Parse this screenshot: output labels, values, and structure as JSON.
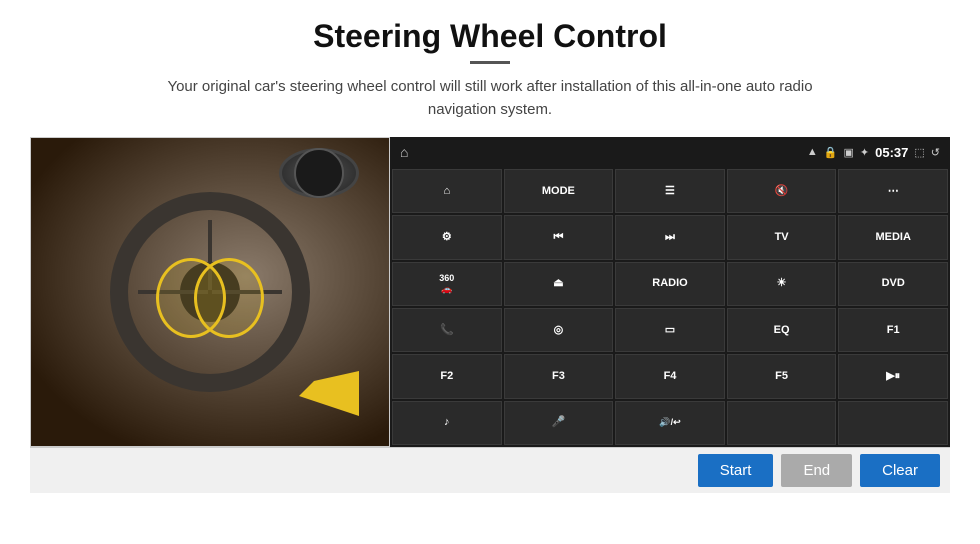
{
  "header": {
    "title": "Steering Wheel Control",
    "subtitle": "Your original car's steering wheel control will still work after installation of this all-in-one auto radio navigation system."
  },
  "status_bar": {
    "time": "05:37",
    "icons": [
      "wifi",
      "lock",
      "sim",
      "bluetooth",
      "camera",
      "back"
    ]
  },
  "grid_buttons": [
    {
      "id": "r1c1",
      "type": "icon",
      "icon": "home",
      "label": ""
    },
    {
      "id": "r1c2",
      "type": "text",
      "label": "MODE"
    },
    {
      "id": "r1c3",
      "type": "icon",
      "icon": "list",
      "label": ""
    },
    {
      "id": "r1c4",
      "type": "icon",
      "icon": "mute",
      "label": ""
    },
    {
      "id": "r1c5",
      "type": "icon",
      "icon": "grid",
      "label": ""
    },
    {
      "id": "r2c1",
      "type": "icon",
      "icon": "settings",
      "label": ""
    },
    {
      "id": "r2c2",
      "type": "icon",
      "icon": "prev",
      "label": ""
    },
    {
      "id": "r2c3",
      "type": "icon",
      "icon": "next",
      "label": ""
    },
    {
      "id": "r2c4",
      "type": "text",
      "label": "TV"
    },
    {
      "id": "r2c5",
      "type": "text",
      "label": "MEDIA"
    },
    {
      "id": "r3c1",
      "type": "icon",
      "icon": "360cam",
      "label": "360"
    },
    {
      "id": "r3c2",
      "type": "icon",
      "icon": "eject",
      "label": ""
    },
    {
      "id": "r3c3",
      "type": "text",
      "label": "RADIO"
    },
    {
      "id": "r3c4",
      "type": "icon",
      "icon": "brightness",
      "label": ""
    },
    {
      "id": "r3c5",
      "type": "text",
      "label": "DVD"
    },
    {
      "id": "r4c1",
      "type": "icon",
      "icon": "phone",
      "label": ""
    },
    {
      "id": "r4c2",
      "type": "icon",
      "icon": "navigation",
      "label": ""
    },
    {
      "id": "r4c3",
      "type": "icon",
      "icon": "screen",
      "label": ""
    },
    {
      "id": "r4c4",
      "type": "text",
      "label": "EQ"
    },
    {
      "id": "r4c5",
      "type": "text",
      "label": "F1"
    },
    {
      "id": "r5c1",
      "type": "text",
      "label": "F2"
    },
    {
      "id": "r5c2",
      "type": "text",
      "label": "F3"
    },
    {
      "id": "r5c3",
      "type": "text",
      "label": "F4"
    },
    {
      "id": "r5c4",
      "type": "text",
      "label": "F5"
    },
    {
      "id": "r5c5",
      "type": "icon",
      "icon": "playpause",
      "label": ""
    },
    {
      "id": "r6c1",
      "type": "icon",
      "icon": "music",
      "label": ""
    },
    {
      "id": "r6c2",
      "type": "icon",
      "icon": "mic",
      "label": ""
    },
    {
      "id": "r6c3",
      "type": "icon",
      "icon": "call",
      "label": ""
    },
    {
      "id": "r6c4",
      "type": "text",
      "label": ""
    },
    {
      "id": "r6c5",
      "type": "text",
      "label": ""
    }
  ],
  "bottom_buttons": {
    "start": "Start",
    "end": "End",
    "clear": "Clear"
  }
}
